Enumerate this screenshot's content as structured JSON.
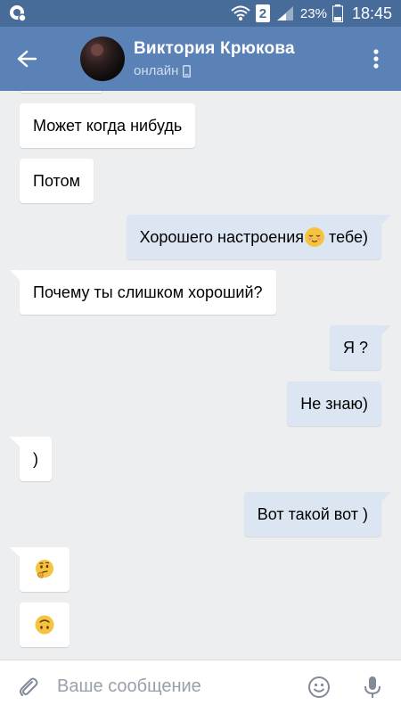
{
  "status_bar": {
    "sim": "2",
    "battery": "23%",
    "time": "18:45"
  },
  "header": {
    "contact_name": "Виктория Крюкова",
    "status": "онлайн"
  },
  "messages": [
    {
      "dir": "in",
      "text": "Может когда нибудь",
      "tail": false
    },
    {
      "dir": "in",
      "text": "Потом",
      "tail": false
    },
    {
      "dir": "out",
      "text": "Хорошего настроения",
      "emoji": "relieved",
      "text_after": " тебе)",
      "tail": true
    },
    {
      "dir": "in",
      "text": "Почему ты слишком хороший?",
      "tail": true
    },
    {
      "dir": "out",
      "text": "Я ?",
      "tail": true
    },
    {
      "dir": "out",
      "text": "Не знаю)",
      "tail": false
    },
    {
      "dir": "in",
      "text": ")",
      "tail": true
    },
    {
      "dir": "out",
      "text": "Вот такой вот )",
      "tail": true
    },
    {
      "dir": "in",
      "emoji": "thinking",
      "tail": true
    },
    {
      "dir": "in",
      "emoji": "upside-down",
      "tail": false
    }
  ],
  "input": {
    "placeholder": "Ваше сообщение"
  },
  "colors": {
    "status_bar": "#486c9a",
    "header": "#5b82b7",
    "background": "#edeef0",
    "incoming_bubble": "#ffffff",
    "outgoing_bubble": "#dce6f3"
  }
}
